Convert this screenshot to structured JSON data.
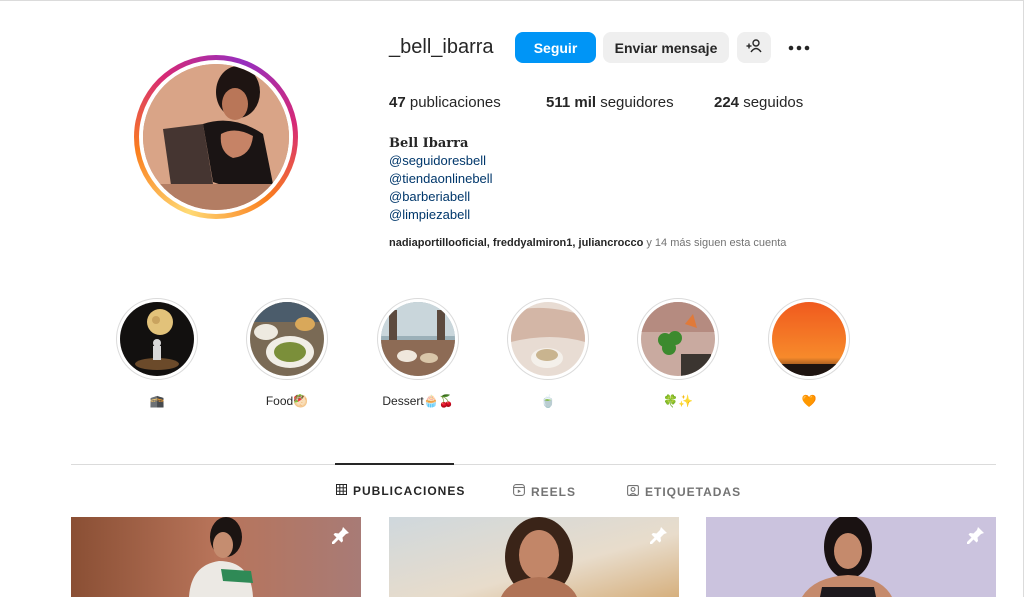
{
  "profile": {
    "username": "_bell_ibarra",
    "follow_label": "Seguir",
    "message_label": "Enviar mensaje",
    "stats": {
      "posts_count": "47",
      "posts_label": "publicaciones",
      "followers_count": "511 mil",
      "followers_label": "seguidores",
      "following_count": "224",
      "following_label": "seguidos"
    },
    "full_name": "Bell Ibarra",
    "bio_mentions": [
      "@seguidoresbell",
      "@tiendaonlinebell",
      "@barberiabell",
      "@limpiezabell"
    ],
    "followed_by": {
      "user1": "nadiaportillooficial",
      "sep1": ", ",
      "user2": "freddyalmiron1",
      "sep2": ", ",
      "user3": "juliancrocco",
      "rest": " y 14 más siguen esta cuenta"
    }
  },
  "highlights": [
    {
      "label": "🕋",
      "icon": "moon-scene"
    },
    {
      "label": "Food🥙",
      "icon": "food-plates"
    },
    {
      "label": "Dessert🧁🍒",
      "icon": "dessert-table"
    },
    {
      "label": "🍵",
      "icon": "tea-cup"
    },
    {
      "label": "🍀✨",
      "icon": "clover"
    },
    {
      "label": "🧡",
      "icon": "sunset"
    }
  ],
  "tabs": [
    {
      "label": "PUBLICACIONES",
      "icon": "grid-icon",
      "active": true
    },
    {
      "label": "REELS",
      "icon": "reels-icon",
      "active": false
    },
    {
      "label": "ETIQUETADAS",
      "icon": "tagged-icon",
      "active": false
    }
  ],
  "posts": [
    {
      "pinned": true
    },
    {
      "pinned": true
    },
    {
      "pinned": true
    }
  ],
  "colors": {
    "follow_button": "#0095f6",
    "secondary_button": "#efefef",
    "link": "#00376b",
    "muted": "#737373"
  }
}
